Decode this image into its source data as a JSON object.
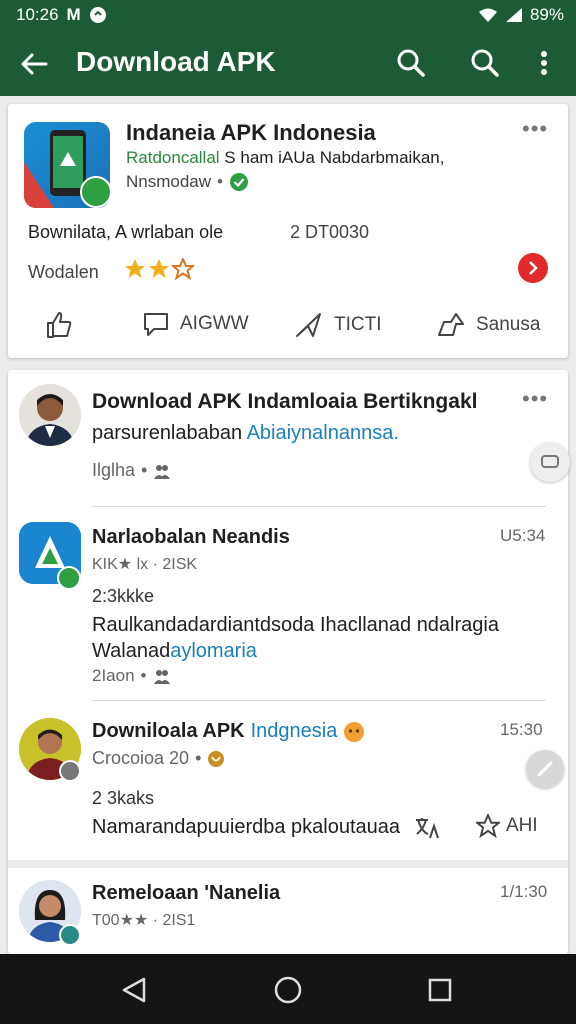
{
  "status": {
    "time": "10:26",
    "left_icons": [
      "M",
      "notification-icon"
    ],
    "battery": "89%"
  },
  "appbar": {
    "title": "Download APK"
  },
  "app_card": {
    "name": "Indaneia APK Indonesia",
    "dev_green": "Ratdoncallal",
    "dev_rest": "S ham iAUa Nabdarbmaikan,",
    "line3": "Nnsmodaw",
    "desc": "Bownilata, A wrlaban ole",
    "size": "2 DT0030",
    "rating_label": "Wodalen",
    "stars": 3,
    "actions": [
      {
        "label": ""
      },
      {
        "label": "AIGWW"
      },
      {
        "label": "TICTI"
      },
      {
        "label": "Sanusa"
      }
    ]
  },
  "posts": [
    {
      "title": "Download APK Indamloaia Bertikngakl",
      "body": "parsurenlababan ",
      "body_link": "Abiaiynalnannsa.",
      "meta": "Ilglha",
      "time": ""
    },
    {
      "title": "Narlaobalan Neandis",
      "sub": "KIK★ lx · 2ISK",
      "time": "U5:34",
      "count": "2:3kkke",
      "body1": "Raulkandadardiantdsoda Ihacllanad ndalragia",
      "body2a": "Walanad",
      "body2b": "aylomaria",
      "meta": "2Iaon"
    },
    {
      "title": "Downiloala APK",
      "title_link": "Indgnesia",
      "sub": "Crocoioa 20",
      "time": "15:30",
      "count": "2 3kaks",
      "body": "Namarandapuuierdba pkaloutauaa",
      "react": "AHI"
    },
    {
      "title": "Remeloaan 'Nanelia",
      "sub": "T00★★ · 2IS1",
      "time": "1/1:30"
    }
  ]
}
